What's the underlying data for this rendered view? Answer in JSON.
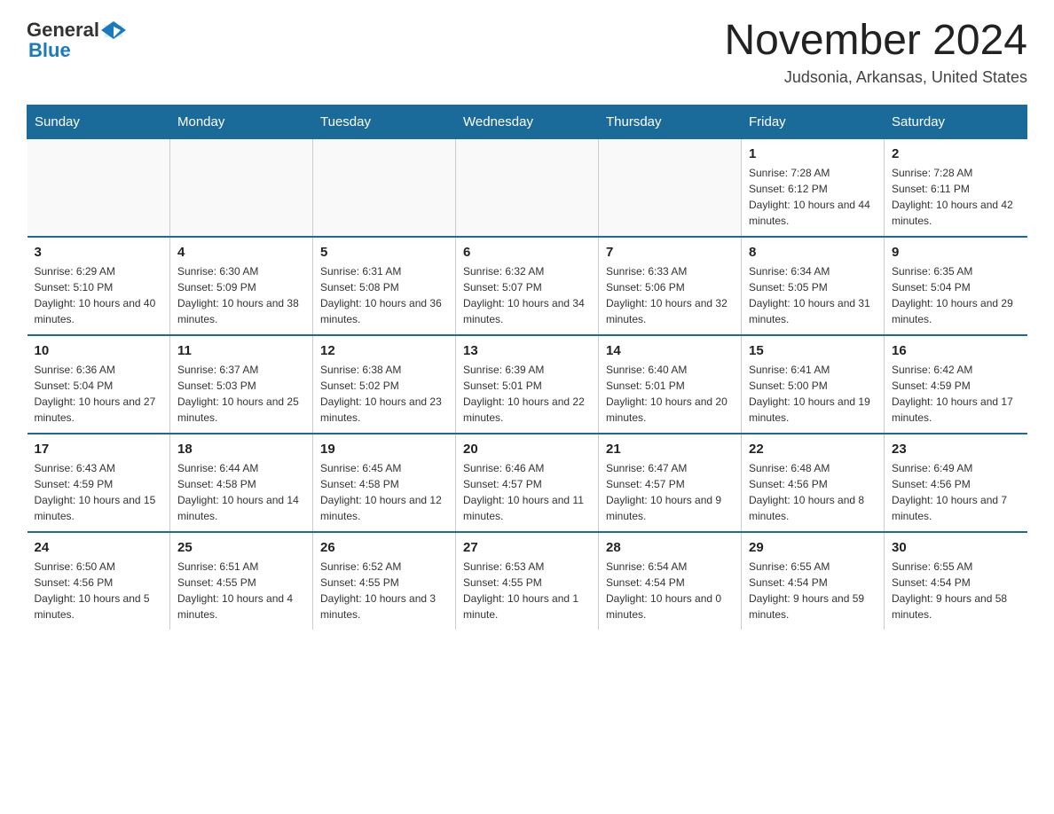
{
  "header": {
    "logo_general": "General",
    "logo_blue": "Blue",
    "month_title": "November 2024",
    "location": "Judsonia, Arkansas, United States"
  },
  "days_of_week": [
    "Sunday",
    "Monday",
    "Tuesday",
    "Wednesday",
    "Thursday",
    "Friday",
    "Saturday"
  ],
  "weeks": [
    {
      "days": [
        {
          "num": "",
          "info": ""
        },
        {
          "num": "",
          "info": ""
        },
        {
          "num": "",
          "info": ""
        },
        {
          "num": "",
          "info": ""
        },
        {
          "num": "",
          "info": ""
        },
        {
          "num": "1",
          "info": "Sunrise: 7:28 AM\nSunset: 6:12 PM\nDaylight: 10 hours and 44 minutes."
        },
        {
          "num": "2",
          "info": "Sunrise: 7:28 AM\nSunset: 6:11 PM\nDaylight: 10 hours and 42 minutes."
        }
      ]
    },
    {
      "days": [
        {
          "num": "3",
          "info": "Sunrise: 6:29 AM\nSunset: 5:10 PM\nDaylight: 10 hours and 40 minutes."
        },
        {
          "num": "4",
          "info": "Sunrise: 6:30 AM\nSunset: 5:09 PM\nDaylight: 10 hours and 38 minutes."
        },
        {
          "num": "5",
          "info": "Sunrise: 6:31 AM\nSunset: 5:08 PM\nDaylight: 10 hours and 36 minutes."
        },
        {
          "num": "6",
          "info": "Sunrise: 6:32 AM\nSunset: 5:07 PM\nDaylight: 10 hours and 34 minutes."
        },
        {
          "num": "7",
          "info": "Sunrise: 6:33 AM\nSunset: 5:06 PM\nDaylight: 10 hours and 32 minutes."
        },
        {
          "num": "8",
          "info": "Sunrise: 6:34 AM\nSunset: 5:05 PM\nDaylight: 10 hours and 31 minutes."
        },
        {
          "num": "9",
          "info": "Sunrise: 6:35 AM\nSunset: 5:04 PM\nDaylight: 10 hours and 29 minutes."
        }
      ]
    },
    {
      "days": [
        {
          "num": "10",
          "info": "Sunrise: 6:36 AM\nSunset: 5:04 PM\nDaylight: 10 hours and 27 minutes."
        },
        {
          "num": "11",
          "info": "Sunrise: 6:37 AM\nSunset: 5:03 PM\nDaylight: 10 hours and 25 minutes."
        },
        {
          "num": "12",
          "info": "Sunrise: 6:38 AM\nSunset: 5:02 PM\nDaylight: 10 hours and 23 minutes."
        },
        {
          "num": "13",
          "info": "Sunrise: 6:39 AM\nSunset: 5:01 PM\nDaylight: 10 hours and 22 minutes."
        },
        {
          "num": "14",
          "info": "Sunrise: 6:40 AM\nSunset: 5:01 PM\nDaylight: 10 hours and 20 minutes."
        },
        {
          "num": "15",
          "info": "Sunrise: 6:41 AM\nSunset: 5:00 PM\nDaylight: 10 hours and 19 minutes."
        },
        {
          "num": "16",
          "info": "Sunrise: 6:42 AM\nSunset: 4:59 PM\nDaylight: 10 hours and 17 minutes."
        }
      ]
    },
    {
      "days": [
        {
          "num": "17",
          "info": "Sunrise: 6:43 AM\nSunset: 4:59 PM\nDaylight: 10 hours and 15 minutes."
        },
        {
          "num": "18",
          "info": "Sunrise: 6:44 AM\nSunset: 4:58 PM\nDaylight: 10 hours and 14 minutes."
        },
        {
          "num": "19",
          "info": "Sunrise: 6:45 AM\nSunset: 4:58 PM\nDaylight: 10 hours and 12 minutes."
        },
        {
          "num": "20",
          "info": "Sunrise: 6:46 AM\nSunset: 4:57 PM\nDaylight: 10 hours and 11 minutes."
        },
        {
          "num": "21",
          "info": "Sunrise: 6:47 AM\nSunset: 4:57 PM\nDaylight: 10 hours and 9 minutes."
        },
        {
          "num": "22",
          "info": "Sunrise: 6:48 AM\nSunset: 4:56 PM\nDaylight: 10 hours and 8 minutes."
        },
        {
          "num": "23",
          "info": "Sunrise: 6:49 AM\nSunset: 4:56 PM\nDaylight: 10 hours and 7 minutes."
        }
      ]
    },
    {
      "days": [
        {
          "num": "24",
          "info": "Sunrise: 6:50 AM\nSunset: 4:56 PM\nDaylight: 10 hours and 5 minutes."
        },
        {
          "num": "25",
          "info": "Sunrise: 6:51 AM\nSunset: 4:55 PM\nDaylight: 10 hours and 4 minutes."
        },
        {
          "num": "26",
          "info": "Sunrise: 6:52 AM\nSunset: 4:55 PM\nDaylight: 10 hours and 3 minutes."
        },
        {
          "num": "27",
          "info": "Sunrise: 6:53 AM\nSunset: 4:55 PM\nDaylight: 10 hours and 1 minute."
        },
        {
          "num": "28",
          "info": "Sunrise: 6:54 AM\nSunset: 4:54 PM\nDaylight: 10 hours and 0 minutes."
        },
        {
          "num": "29",
          "info": "Sunrise: 6:55 AM\nSunset: 4:54 PM\nDaylight: 9 hours and 59 minutes."
        },
        {
          "num": "30",
          "info": "Sunrise: 6:55 AM\nSunset: 4:54 PM\nDaylight: 9 hours and 58 minutes."
        }
      ]
    }
  ]
}
